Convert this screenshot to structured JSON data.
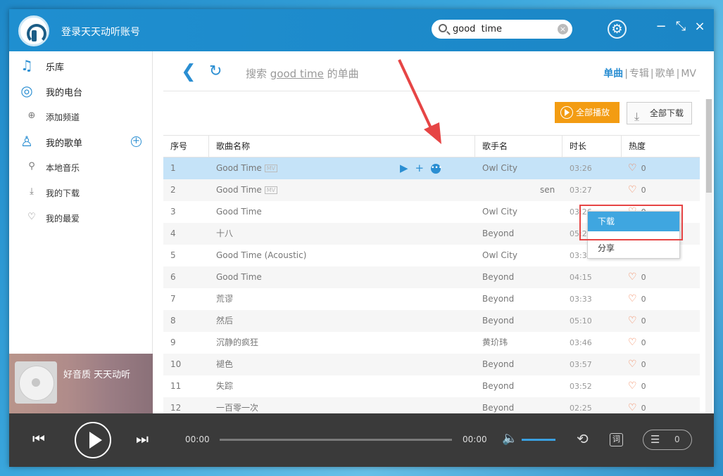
{
  "app": {
    "login_text": "登录天天动听账号",
    "search_value": "good  time",
    "window_buttons": {
      "minimize": "−",
      "restore": "⤡",
      "close": "×"
    }
  },
  "sidebar": {
    "library": "乐库",
    "my_radio": "我的电台",
    "add_channel": "添加频道",
    "my_playlists": "我的歌单",
    "local_music": "本地音乐",
    "my_downloads": "我的下载",
    "my_favorites": "我的最爱",
    "promo_text": "好音质 天天动听"
  },
  "main": {
    "query_prefix": "搜索",
    "query_keyword": "good  time",
    "query_suffix": "的单曲",
    "tabs": [
      "单曲",
      "专辑",
      "歌单",
      "MV"
    ],
    "tab_sep": "|",
    "play_all": "全部播放",
    "download_all": "全部下载",
    "columns": {
      "no": "序号",
      "name": "歌曲名称",
      "artist": "歌手名",
      "duration": "时长",
      "hot": "热度"
    },
    "rows": [
      {
        "no": "1",
        "name": "Good Time",
        "mv": "MV",
        "artist": "Owl City",
        "duration": "03:26",
        "hot": "0"
      },
      {
        "no": "2",
        "name": "Good Time",
        "mv": "MV",
        "artist": "sen",
        "duration": "03:27",
        "hot": "0"
      },
      {
        "no": "3",
        "name": "Good Time",
        "artist": "Owl City",
        "duration": "03:26",
        "hot": "0"
      },
      {
        "no": "4",
        "name": "十八",
        "artist": "Beyond",
        "duration": "05:20",
        "hot": "0"
      },
      {
        "no": "5",
        "name": "Good Time (Acoustic)",
        "artist": "Owl City",
        "duration": "03:35",
        "hot": "0"
      },
      {
        "no": "6",
        "name": "Good Time",
        "artist": "Beyond",
        "duration": "04:15",
        "hot": "0"
      },
      {
        "no": "7",
        "name": "荒谬",
        "artist": "Beyond",
        "duration": "03:33",
        "hot": "0"
      },
      {
        "no": "8",
        "name": "然后",
        "artist": "Beyond",
        "duration": "05:10",
        "hot": "0"
      },
      {
        "no": "9",
        "name": "沉静的疯狂",
        "artist": "黄玠玮",
        "duration": "03:46",
        "hot": "0"
      },
      {
        "no": "10",
        "name": "褪色",
        "artist": "Beyond",
        "duration": "03:57",
        "hot": "0"
      },
      {
        "no": "11",
        "name": "失踪",
        "artist": "Beyond",
        "duration": "03:52",
        "hot": "0"
      },
      {
        "no": "12",
        "name": "一百零一次",
        "artist": "Beyond",
        "duration": "02:25",
        "hot": "0"
      }
    ],
    "context_menu": [
      "下载",
      "分享"
    ]
  },
  "player": {
    "time_current": "00:00",
    "time_total": "00:00",
    "lyric_label": "词",
    "queue_count": "0"
  },
  "colors": {
    "accent": "#2a8ed2",
    "orange": "#f39c12",
    "highlight_red": "#e64545"
  },
  "icons": [
    "logo-icon",
    "search-icon",
    "clear-icon",
    "gear-icon",
    "music-note-icon",
    "radio-icon",
    "user-icon",
    "pin-icon",
    "download-icon",
    "heart-icon",
    "play-icon",
    "prev-icon",
    "next-icon",
    "volume-icon",
    "loop-icon",
    "queue-icon"
  ]
}
